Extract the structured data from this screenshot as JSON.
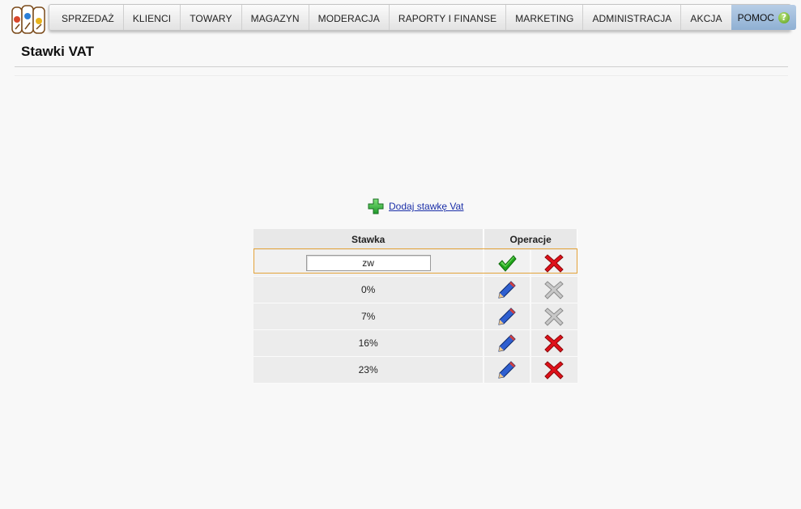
{
  "nav": {
    "items": [
      "SPRZEDAŻ",
      "KLIENCI",
      "TOWARY",
      "MAGAZYN",
      "MODERACJA",
      "RAPORTY I FINANSE",
      "MARKETING",
      "ADMINISTRACJA",
      "AKCJA"
    ],
    "help_label": "POMOC",
    "help_icon": "?"
  },
  "page": {
    "title": "Stawki VAT"
  },
  "add_link": {
    "label": "Dodaj stawkę Vat",
    "icon": "plus-icon"
  },
  "table": {
    "headers": {
      "rate": "Stawka",
      "operations": "Operacje"
    },
    "edit_row": {
      "value": "zw",
      "icons": [
        "checkmark-icon",
        "delete-icon"
      ]
    },
    "rows": [
      {
        "rate": "0%",
        "delete_enabled": false
      },
      {
        "rate": "7%",
        "delete_enabled": false
      },
      {
        "rate": "16%",
        "delete_enabled": true
      },
      {
        "rate": "23%",
        "delete_enabled": true
      }
    ]
  },
  "colors": {
    "accent_link": "#1b2fa8",
    "edit_border": "#e3a33a",
    "delete_red": "#e0101a",
    "confirm_green": "#1fa51a"
  }
}
